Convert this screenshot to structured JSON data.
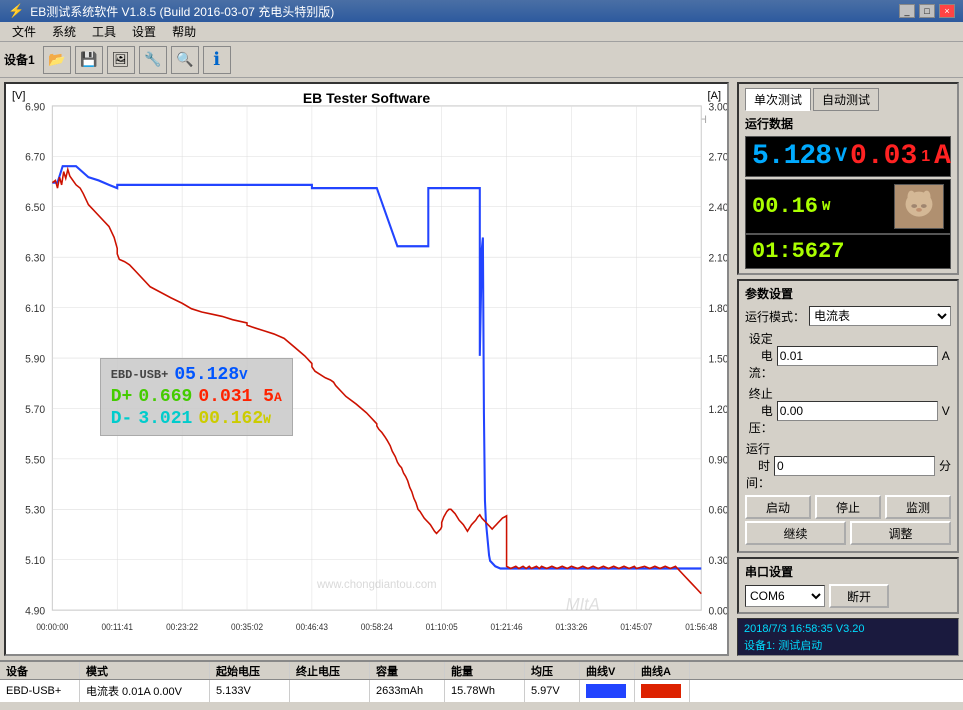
{
  "window": {
    "title": "EB测试系统软件 V1.8.5 (Build 2016-03-07 充电头特别版)",
    "controls": [
      "_",
      "□",
      "×"
    ]
  },
  "menu": {
    "items": [
      "文件",
      "系统",
      "工具",
      "设置",
      "帮助"
    ]
  },
  "toolbar": {
    "label": "设备1",
    "buttons": [
      "📂",
      "💾",
      "🖼",
      "🔧",
      "🔍",
      "ℹ"
    ]
  },
  "chart": {
    "title": "EB Tester Software",
    "brand": "ZKETECH",
    "ylabel_left": "[V]",
    "ylabel_right": "[A]",
    "y_left_max": "6.90",
    "y_left_ticks": [
      "6.90",
      "6.70",
      "6.50",
      "6.30",
      "6.10",
      "5.90",
      "5.70",
      "5.50",
      "5.30",
      "5.10",
      "4.90"
    ],
    "y_right_ticks": [
      "3.00",
      "2.70",
      "2.40",
      "2.10",
      "1.80",
      "1.50",
      "1.20",
      "0.90",
      "0.60",
      "0.30",
      "0.00"
    ],
    "x_ticks": [
      "00:00:00",
      "00:11:41",
      "00:23:22",
      "00:35:02",
      "00:46:43",
      "00:58:24",
      "01:10:05",
      "01:21:46",
      "01:33:26",
      "01:45:07",
      "01:56:48"
    ],
    "watermark": "www.chongdiantou.com"
  },
  "overlay": {
    "label_main": "EBD-USB+",
    "val_main": "05.128V",
    "label_d_plus": "D+",
    "val_d_plus": "0.669",
    "val_current": "0.031 5A",
    "label_d_minus": "D-",
    "val_d_minus": "3.021",
    "val_power": "00.162W"
  },
  "right_panel": {
    "tabs": [
      "单次测试",
      "自动测试"
    ],
    "section_run": "运行数据",
    "voltage_val": "5.128",
    "voltage_unit": "V",
    "current_val": "0.03",
    "current_unit": "1A",
    "power_val": "00.16",
    "power_unit": "W",
    "timer_val": "01:5627",
    "section_param": "参数设置",
    "mode_label": "运行模式：",
    "mode_value": "电流表",
    "current_label": "设定电流：",
    "current_value": "0.01",
    "current_unit2": "A",
    "voltage_label": "终止电压：",
    "voltage_value": "0.00",
    "voltage_unit2": "V",
    "time_label": "运行时间：",
    "time_value": "0",
    "time_unit": "分",
    "btn_start": "启动",
    "btn_stop": "停止",
    "btn_monitor": "监测",
    "btn_continue": "继续",
    "btn_adjust": "调整",
    "section_serial": "串口设置",
    "com_value": "COM6",
    "btn_disconnect": "断开",
    "log_line1": "2018/7/3 16:58:35  V3.20",
    "log_line2": "设备1: 测试启动"
  },
  "table": {
    "headers": [
      "设备",
      "模式",
      "起始电压",
      "终止电压",
      "容量",
      "能量",
      "均压",
      "曲线V",
      "曲线A"
    ],
    "rows": [
      {
        "device": "EBD-USB+",
        "mode": "电流表 0.01A 0.00V",
        "start_v": "5.133V",
        "end_v": "",
        "capacity": "2633mAh",
        "energy": "15.78Wh",
        "avg_v": "5.97V",
        "curve_v_color": "#2244ff",
        "curve_a_color": "#dd2200"
      }
    ]
  }
}
